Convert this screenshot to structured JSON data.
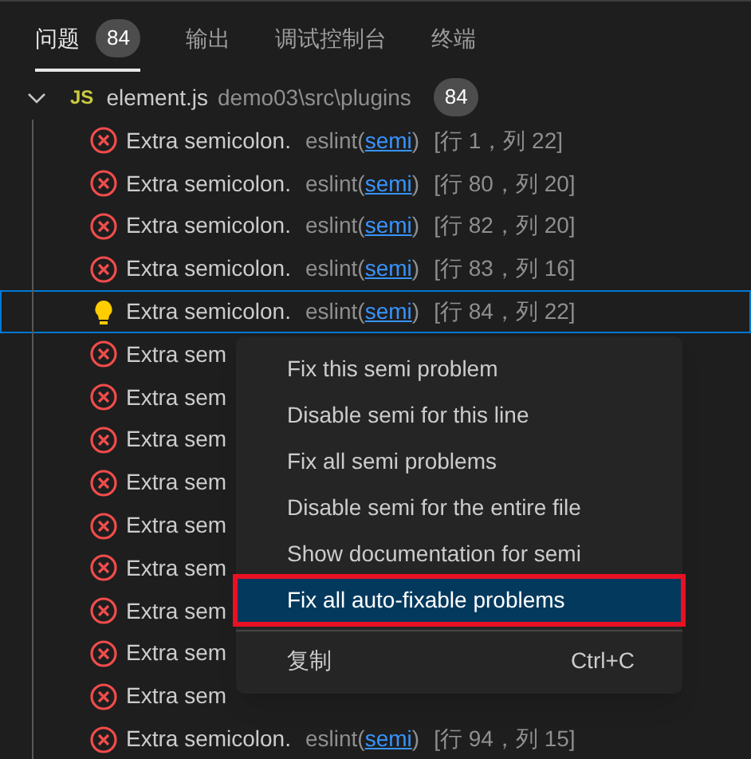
{
  "tabs": [
    {
      "label": "问题",
      "badge": "84",
      "selected": true
    },
    {
      "label": "输出",
      "selected": false
    },
    {
      "label": "调试控制台",
      "selected": false
    },
    {
      "label": "终端",
      "selected": false
    }
  ],
  "file": {
    "expanded": true,
    "icon": "JS",
    "name": "element.js",
    "path": "demo03\\src\\plugins",
    "count": "84"
  },
  "problems": [
    {
      "kind": "error",
      "message": "Extra semicolon.",
      "source": "eslint(",
      "rule": "semi",
      "close": ")",
      "location": "[行 1，列 22]",
      "selected": false
    },
    {
      "kind": "error",
      "message": "Extra semicolon.",
      "source": "eslint(",
      "rule": "semi",
      "close": ")",
      "location": "[行 80，列 20]",
      "selected": false
    },
    {
      "kind": "error",
      "message": "Extra semicolon.",
      "source": "eslint(",
      "rule": "semi",
      "close": ")",
      "location": "[行 82，列 20]",
      "selected": false
    },
    {
      "kind": "error",
      "message": "Extra semicolon.",
      "source": "eslint(",
      "rule": "semi",
      "close": ")",
      "location": "[行 83，列 16]",
      "selected": false
    },
    {
      "kind": "fix",
      "message": "Extra semicolon.",
      "source": "eslint(",
      "rule": "semi",
      "close": ")",
      "location": "[行 84，列 22]",
      "selected": true
    },
    {
      "kind": "error",
      "message": "Extra sem",
      "selected": false
    },
    {
      "kind": "error",
      "message": "Extra sem",
      "selected": false
    },
    {
      "kind": "error",
      "message": "Extra sem",
      "selected": false
    },
    {
      "kind": "error",
      "message": "Extra sem",
      "selected": false
    },
    {
      "kind": "error",
      "message": "Extra sem",
      "selected": false
    },
    {
      "kind": "error",
      "message": "Extra sem",
      "selected": false
    },
    {
      "kind": "error",
      "message": "Extra sem",
      "selected": false
    },
    {
      "kind": "error",
      "message": "Extra sem",
      "selected": false
    },
    {
      "kind": "error",
      "message": "Extra sem",
      "selected": false
    },
    {
      "kind": "error",
      "message": "Extra semicolon.",
      "source": "eslint(",
      "rule": "semi",
      "close": ")",
      "location": "[行 94，列 15]",
      "selected": false
    }
  ],
  "context_menu": {
    "items": [
      {
        "kind": "item",
        "label": "Fix this semi problem",
        "selected": false,
        "highlighted": false
      },
      {
        "kind": "item",
        "label": "Disable semi for this line",
        "selected": false,
        "highlighted": false
      },
      {
        "kind": "item",
        "label": "Fix all semi problems",
        "selected": false,
        "highlighted": false
      },
      {
        "kind": "item",
        "label": "Disable semi for the entire file",
        "selected": false,
        "highlighted": false
      },
      {
        "kind": "item",
        "label": "Show documentation for semi",
        "selected": false,
        "highlighted": false
      },
      {
        "kind": "item",
        "label": "Fix all auto-fixable problems",
        "selected": true,
        "highlighted": true
      },
      {
        "kind": "separator"
      },
      {
        "kind": "item",
        "label": "复制",
        "shortcut": "Ctrl+C",
        "selected": false,
        "highlighted": false
      }
    ]
  }
}
